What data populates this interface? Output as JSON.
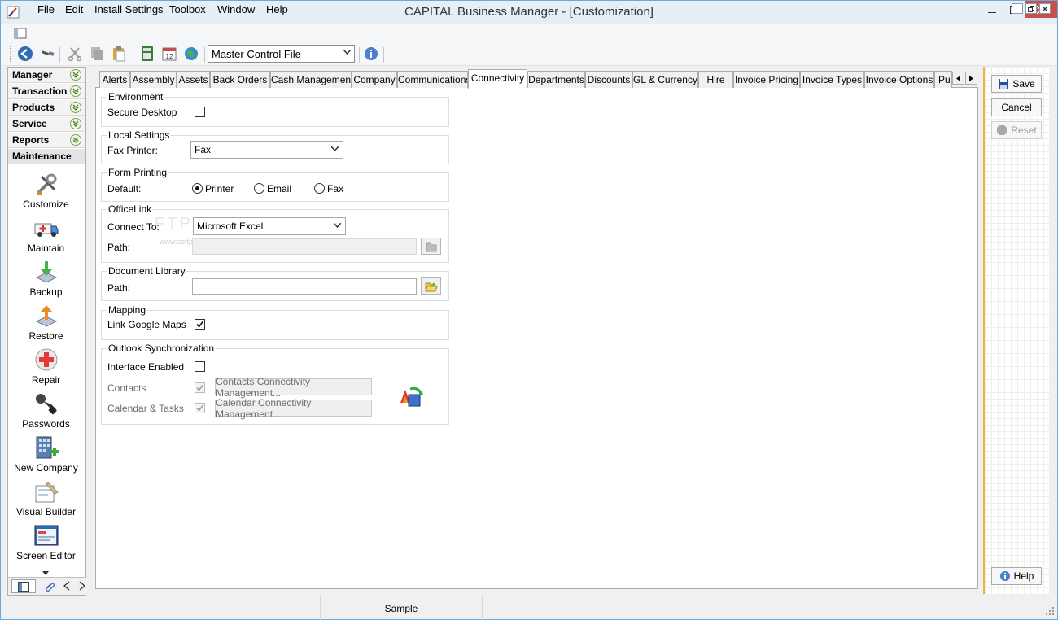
{
  "window": {
    "title": "CAPITAL Business Manager - [Customization]"
  },
  "menu": [
    "File",
    "Edit",
    "Install Settings",
    "Toolbox",
    "Window",
    "Help"
  ],
  "toolbar": {
    "file_select": "Master Control File"
  },
  "nav": {
    "groups": [
      "Manager",
      "Transaction",
      "Products",
      "Service",
      "Reports",
      "Maintenance"
    ],
    "items": [
      "Customize",
      "Maintain",
      "Backup",
      "Restore",
      "Repair",
      "Passwords",
      "New Company",
      "Visual Builder",
      "Screen Editor"
    ]
  },
  "tabs": [
    "Alerts",
    "Assembly",
    "Assets",
    "Back Orders",
    "Cash Management",
    "Company",
    "Communications",
    "Connectivity",
    "Departments",
    "Discounts",
    "GL & Currency",
    "Hire",
    "Invoice Pricing",
    "Invoice Types",
    "Invoice Options",
    "Pu"
  ],
  "active_tab": "Connectivity",
  "form": {
    "environment": {
      "title": "Environment",
      "secure_desktop_label": "Secure Desktop",
      "secure_desktop": false
    },
    "local_settings": {
      "title": "Local Settings",
      "fax_printer_label": "Fax Printer:",
      "fax_printer": "Fax"
    },
    "form_printing": {
      "title": "Form Printing",
      "default_label": "Default:",
      "options": [
        "Printer",
        "Email",
        "Fax"
      ],
      "selected": "Printer"
    },
    "officelink": {
      "title": "OfficeLink",
      "connect_label": "Connect To:",
      "connect_value": "Microsoft Excel",
      "path_label": "Path:",
      "path_value": ""
    },
    "document_library": {
      "title": "Document Library",
      "path_label": "Path:",
      "path_value": ""
    },
    "mapping": {
      "title": "Mapping",
      "google_label": "Link Google Maps",
      "google": true
    },
    "outlook": {
      "title": "Outlook Synchronization",
      "interface_label": "Interface Enabled",
      "interface": false,
      "contacts_label": "Contacts",
      "contacts_button": "Contacts Connectivity Management...",
      "calendar_label": "Calendar & Tasks",
      "calendar_button": "Calendar Connectivity Management..."
    }
  },
  "actions": {
    "save": "Save",
    "cancel": "Cancel",
    "reset": "Reset",
    "help": "Help"
  },
  "status": {
    "center": "Sample"
  },
  "watermark": {
    "big": "FTPEDIA",
    "small": "www.softpedia.com"
  },
  "colors": {
    "accent_separator": "#f0b43a",
    "close_button": "#c7504b",
    "title_bar": "#e6eef6"
  }
}
